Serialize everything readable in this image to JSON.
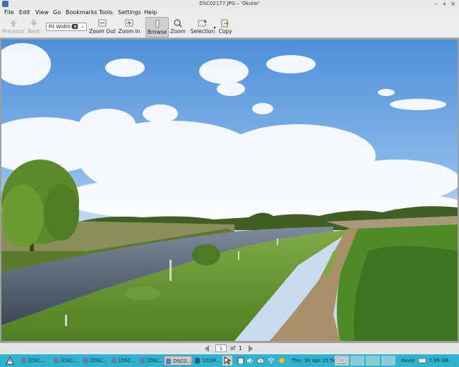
{
  "window": {
    "title": "DSC02177.JPG – 'Okular'",
    "min_glyph": "–",
    "max_glyph": "+",
    "close_glyph": "×"
  },
  "menu": [
    "File",
    "Edit",
    "View",
    "Go",
    "Bookmarks",
    "Tools",
    "Settings",
    "Help"
  ],
  "toolbar": {
    "previous": "Previous",
    "next": "Next",
    "zoom_value": "Fit Width",
    "zoom_out": "Zoom Out",
    "zoom_in": "Zoom In",
    "browse": "Browse",
    "zoom": "Zoom",
    "selection": "Selection",
    "copy": "Copy"
  },
  "pagenav": {
    "current": "1",
    "of": "of",
    "total": "1"
  },
  "taskbar": {
    "tasks": [
      "[DSC...",
      "[DSC...",
      "[DSC...",
      "[DSC...",
      "[DSC...",
      "DSC0...",
      "101M..."
    ],
    "clock": "Thu, 30 Apr  15:54",
    "user": "david",
    "disk": "7.99 GB"
  },
  "colors": {
    "taskbar": "#2fb3cf",
    "toolbar": "#ececec",
    "sky": "#6aa4e3",
    "grass": "#5a8c2a",
    "water": "#4b5a6a"
  }
}
